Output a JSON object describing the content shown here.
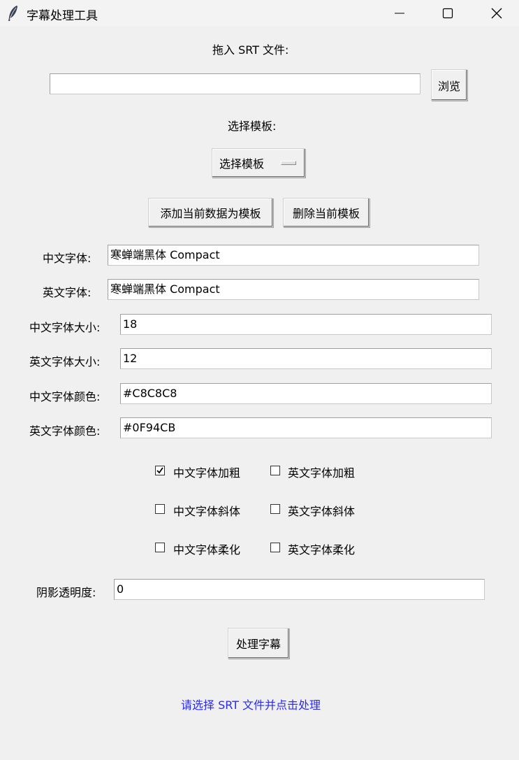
{
  "window": {
    "title": "字幕处理工具"
  },
  "srt": {
    "drop_label": "拖入 SRT 文件:",
    "path_value": "",
    "browse_label": "浏览"
  },
  "template": {
    "choose_label": "选择模板:",
    "menu_value": "选择模板",
    "add_label": "添加当前数据为模板",
    "delete_label": "删除当前模板"
  },
  "fields": {
    "cn_font_label": "中文字体:",
    "cn_font_value": "寒蝉端黑体 Compact",
    "en_font_label": "英文字体:",
    "en_font_value": "寒蝉端黑体 Compact",
    "cn_size_label": "中文字体大小:",
    "cn_size_value": "18",
    "en_size_label": "英文字体大小:",
    "en_size_value": "12",
    "cn_color_label": "中文字体颜色:",
    "cn_color_value": "#C8C8C8",
    "en_color_label": "英文字体颜色:",
    "en_color_value": "#0F94CB"
  },
  "options": {
    "cn_bold": {
      "label": "中文字体加粗",
      "checked": true
    },
    "en_bold": {
      "label": "英文字体加粗",
      "checked": false
    },
    "cn_italic": {
      "label": "中文字体斜体",
      "checked": false
    },
    "en_italic": {
      "label": "英文字体斜体",
      "checked": false
    },
    "cn_soft": {
      "label": "中文字体柔化",
      "checked": false
    },
    "en_soft": {
      "label": "英文字体柔化",
      "checked": false
    }
  },
  "shadow": {
    "label": "阴影透明度:",
    "value": "0"
  },
  "actions": {
    "process_label": "处理字幕"
  },
  "status": {
    "text": "请选择 SRT 文件并点击处理",
    "color": "#2a2af5"
  },
  "icons": {
    "app": "feather-icon",
    "minimize": "minimize-icon",
    "maximize": "maximize-icon",
    "close": "close-icon"
  }
}
